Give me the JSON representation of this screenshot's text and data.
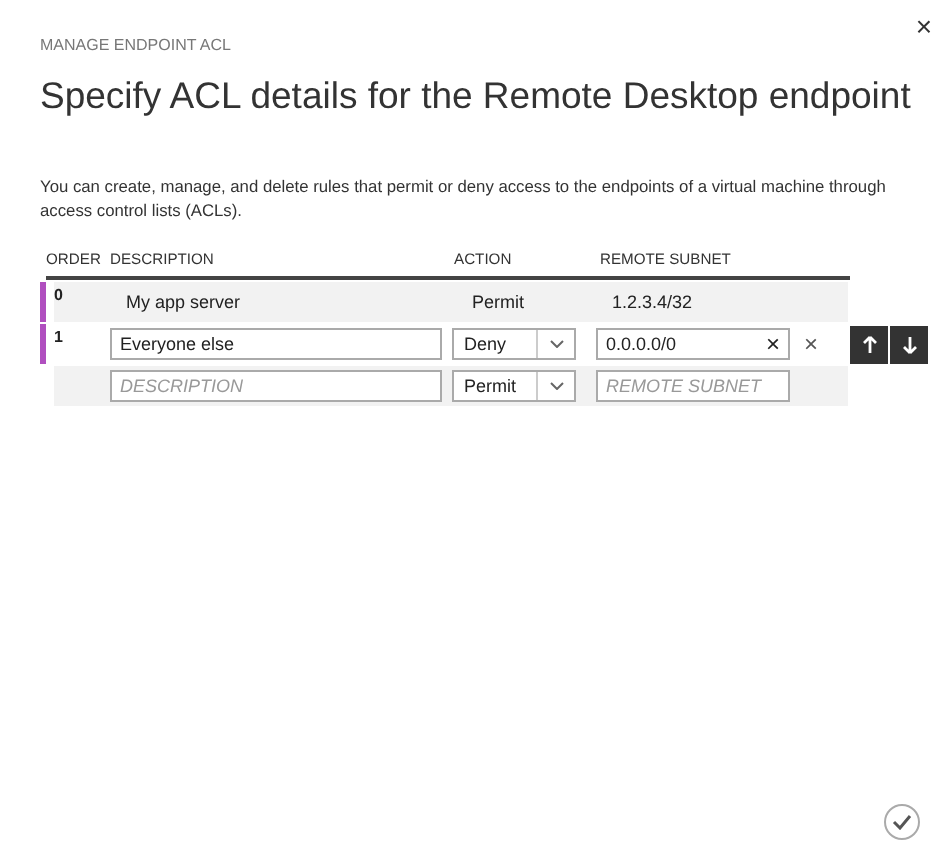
{
  "close_button": "×",
  "subtitle": "MANAGE ENDPOINT ACL",
  "title": "Specify ACL details for the Remote Desktop endpoint",
  "description": "You can create, manage, and delete rules that permit or deny access to the endpoints of a virtual machine through access control lists (ACLs).",
  "table": {
    "columns": [
      "ORDER",
      "DESCRIPTION",
      "ACTION",
      "REMOTE SUBNET"
    ],
    "rows": [
      {
        "kind": "view",
        "order": "0",
        "description": "My app server",
        "action": "Permit",
        "remote_subnet": "1.2.3.4/32"
      },
      {
        "kind": "edit",
        "order": "1",
        "description": "Everyone else",
        "action": "Deny",
        "remote_subnet": "0.0.0.0/0"
      },
      {
        "kind": "new",
        "description_placeholder": "DESCRIPTION",
        "action": "Permit",
        "remote_subnet_placeholder": "REMOTE SUBNET"
      }
    ]
  }
}
